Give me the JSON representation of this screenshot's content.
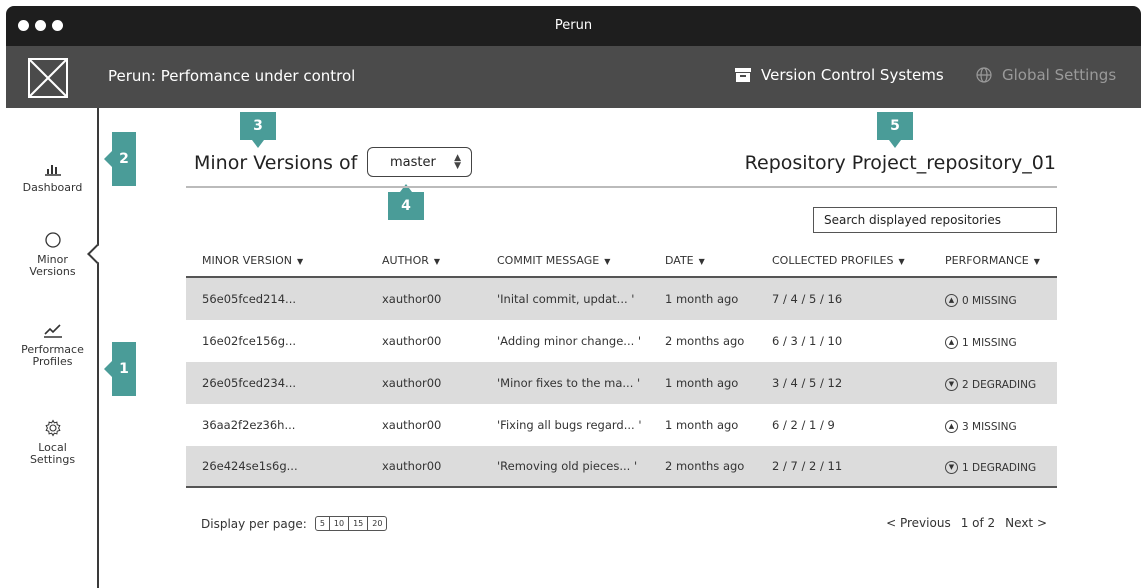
{
  "window": {
    "title": "Perun"
  },
  "header": {
    "app_title": "Perun: Perfomance under control",
    "vcs_label": "Version Control Systems",
    "global_settings_label": "Global Settings"
  },
  "sidebar": {
    "items": [
      {
        "label_line1": "Dashboard",
        "label_line2": "",
        "icon": "bar-chart-icon"
      },
      {
        "label_line1": "Minor",
        "label_line2": "Versions",
        "icon": "circle-icon",
        "active": true
      },
      {
        "label_line1": "Performace",
        "label_line2": "Profiles",
        "icon": "line-chart-icon"
      },
      {
        "label_line1": "Local",
        "label_line2": "Settings",
        "icon": "gear-icon"
      }
    ]
  },
  "annotations": {
    "b1": "1",
    "b2": "2",
    "b3": "3",
    "b4": "4",
    "b5": "5"
  },
  "main": {
    "heading": "Minor Versions of",
    "branch": "master",
    "repo_title": "Repository Project_repository_01",
    "search_placeholder": "Search displayed repositories"
  },
  "table": {
    "columns": [
      "MINOR VERSION",
      "AUTHOR",
      "COMMIT MESSAGE",
      "DATE",
      "COLLECTED PROFILES",
      "PERFORMANCE"
    ],
    "rows": [
      {
        "version": "56e05fced214...",
        "author": "xauthor00",
        "message": "'Inital commit, updat... '",
        "date": "1 month ago",
        "profiles": "7 / 4 / 5 / 16",
        "perf_dir": "up",
        "performance": "0 MISSING"
      },
      {
        "version": "16e02fce156g...",
        "author": "xauthor00",
        "message": "'Adding minor change... '",
        "date": "2 months ago",
        "profiles": "6 / 3 / 1 / 10",
        "perf_dir": "up",
        "performance": "1 MISSING"
      },
      {
        "version": "26e05fced234...",
        "author": "xauthor00",
        "message": "'Minor fixes to the ma... '",
        "date": "1 month ago",
        "profiles": "3 / 4 / 5 / 12",
        "perf_dir": "down",
        "performance": "2 DEGRADING"
      },
      {
        "version": "36aa2f2ez36h...",
        "author": "xauthor00",
        "message": "'Fixing all bugs regard... '",
        "date": "1 month ago",
        "profiles": "6 / 2 / 1 / 9",
        "perf_dir": "up",
        "performance": "3 MISSING"
      },
      {
        "version": "26e424se1s6g...",
        "author": "xauthor00",
        "message": "'Removing old pieces... '",
        "date": "2 months ago",
        "profiles": "2 / 7 / 2 / 11",
        "perf_dir": "down",
        "performance": "1 DEGRADING"
      }
    ]
  },
  "footer": {
    "per_page_label": "Display per page:",
    "per_page_options": [
      "5",
      "10",
      "15",
      "20"
    ],
    "previous": "< Previous",
    "page_info": "1 of 2",
    "next": "Next >"
  },
  "colors": {
    "accent": "#4a9c98",
    "titlebar": "#1e1e1e",
    "header": "#4b4b4b",
    "row_shade": "#dcdcdc"
  }
}
